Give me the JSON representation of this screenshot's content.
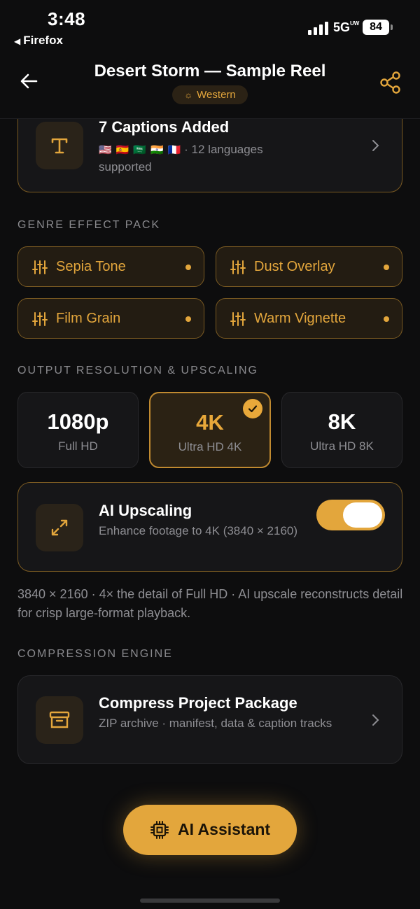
{
  "status_bar": {
    "time": "3:48",
    "back_app": "Firefox",
    "network": "5G",
    "network_sup": "UW",
    "battery": "84"
  },
  "header": {
    "title": "Desert Storm — Sample Reel",
    "genre": "Western",
    "back_icon": "arrow-left-icon",
    "share_icon": "share-icon"
  },
  "captions_card": {
    "title": "7 Captions Added",
    "flags": [
      "🇺🇸",
      "🇪🇸",
      "🇸🇦",
      "🇮🇳",
      "🇫🇷"
    ],
    "languages": " · 12 languages",
    "supported": "supported",
    "icon": "text-icon"
  },
  "effects": {
    "section_label": "GENRE EFFECT PACK",
    "items": [
      {
        "label": "Sepia Tone"
      },
      {
        "label": "Dust Overlay"
      },
      {
        "label": "Film Grain"
      },
      {
        "label": "Warm Vignette"
      }
    ]
  },
  "resolution": {
    "section_label": "OUTPUT RESOLUTION & UPSCALING",
    "options": [
      {
        "big": "1080p",
        "small": "Full HD",
        "selected": false
      },
      {
        "big": "4K",
        "small": "Ultra HD 4K",
        "selected": true
      },
      {
        "big": "8K",
        "small": "Ultra HD 8K",
        "selected": false
      }
    ]
  },
  "upscaling": {
    "title": "AI Upscaling",
    "subtitle": "Enhance footage to 4K (3840 × 2160)",
    "enabled": true,
    "note": "3840 × 2160 · 4× the detail of Full HD · AI upscale reconstructs detail for crisp large-format playback."
  },
  "compression": {
    "section_label": "COMPRESSION ENGINE",
    "title": "Compress Project Package",
    "subtitle": "ZIP archive · manifest, data & caption tracks"
  },
  "assistant": {
    "label": "AI Assistant"
  },
  "colors": {
    "accent": "#e3a63c",
    "background": "#0d0d0e",
    "card": "#161618"
  }
}
